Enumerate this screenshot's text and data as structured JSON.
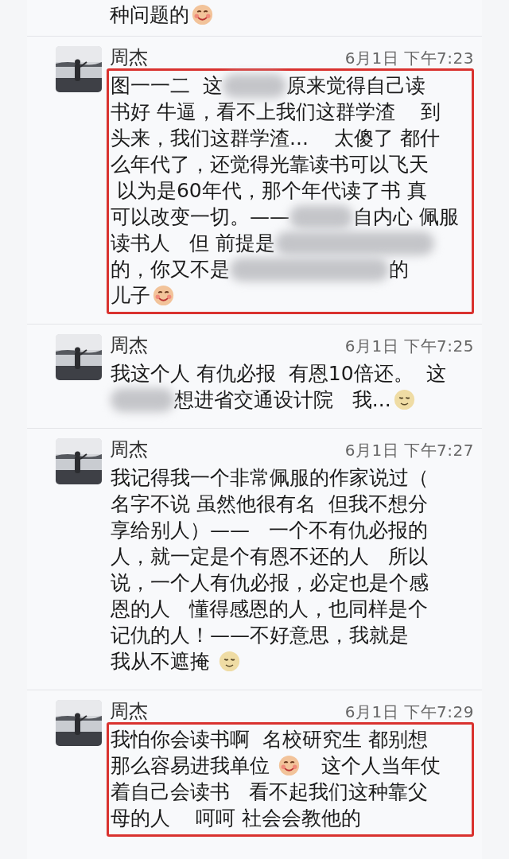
{
  "top_message": {
    "lines": [
      [
        {
          "kind": "text",
          "text": "种问题的"
        },
        {
          "kind": "emoji_blush"
        }
      ]
    ]
  },
  "messages": [
    {
      "name": "周杰",
      "time": "6月1日 下午7:23",
      "highlighted": true,
      "lines": [
        [
          {
            "kind": "text",
            "text": "图一一二  这"
          },
          {
            "kind": "blur_short"
          },
          {
            "kind": "text",
            "text": "原来觉得自己读"
          }
        ],
        [
          {
            "kind": "text",
            "text": "书好 牛逼，看不上我们这群学渣    到"
          }
        ],
        [
          {
            "kind": "text",
            "text": "头来，我们这群学渣...    太傻了 都什"
          }
        ],
        [
          {
            "kind": "text",
            "text": "么年代了，还觉得光靠读书可以飞天"
          }
        ],
        [
          {
            "kind": "text",
            "text": " 以为是60年代，那个年代读了书 真"
          }
        ],
        [
          {
            "kind": "text",
            "text": "可以改变一切。——"
          },
          {
            "kind": "blur_short"
          },
          {
            "kind": "text",
            "text": "自内心 佩服"
          }
        ],
        [
          {
            "kind": "text",
            "text": "读书人   但 前提是"
          },
          {
            "kind": "blur_long"
          }
        ],
        [
          {
            "kind": "text",
            "text": "的，你又不是"
          },
          {
            "kind": "blur_long"
          },
          {
            "kind": "text",
            "text": "的"
          }
        ],
        [
          {
            "kind": "text",
            "text": "儿子"
          },
          {
            "kind": "emoji_blush"
          }
        ]
      ]
    },
    {
      "name": "周杰",
      "time": "6月1日 下午7:25",
      "highlighted": false,
      "lines": [
        [
          {
            "kind": "text",
            "text": "我这个人 有仇必报  有恩10倍还。  这"
          }
        ],
        [
          {
            "kind": "blur_short"
          },
          {
            "kind": "text",
            "text": "想进省交通设计院   我..."
          },
          {
            "kind": "emoji_relaxed"
          }
        ]
      ]
    },
    {
      "name": "周杰",
      "time": "6月1日 下午7:27",
      "highlighted": false,
      "lines": [
        [
          {
            "kind": "text",
            "text": "我记得我一个非常佩服的作家说过（"
          }
        ],
        [
          {
            "kind": "text",
            "text": "名字不说 虽然他很有名  但我不想分"
          }
        ],
        [
          {
            "kind": "text",
            "text": "享给别人）——   一个不有仇必报的"
          }
        ],
        [
          {
            "kind": "text",
            "text": "人，就一定是个有恩不还的人   所以"
          }
        ],
        [
          {
            "kind": "text",
            "text": "说，一个人有仇必报，必定也是个感"
          }
        ],
        [
          {
            "kind": "text",
            "text": "恩的人   懂得感恩的人，也同样是个"
          }
        ],
        [
          {
            "kind": "text",
            "text": "记仇的人！——不好意思，我就是"
          }
        ],
        [
          {
            "kind": "text",
            "text": "我从不遮掩 "
          },
          {
            "kind": "emoji_relaxed"
          }
        ]
      ]
    },
    {
      "name": "周杰",
      "time": "6月1日 下午7:29",
      "highlighted": true,
      "lines": [
        [
          {
            "kind": "text",
            "text": "我怕你会读书啊  名校研究生 都别想"
          }
        ],
        [
          {
            "kind": "text",
            "text": "那么容易进我单位 "
          },
          {
            "kind": "emoji_blush"
          },
          {
            "kind": "text",
            "text": "   这个人当年仗"
          }
        ],
        [
          {
            "kind": "text",
            "text": "着自己会读书   看不起我们这种靠父"
          }
        ],
        [
          {
            "kind": "text",
            "text": "母的人    呵呵 社会会教他的"
          }
        ]
      ]
    }
  ]
}
